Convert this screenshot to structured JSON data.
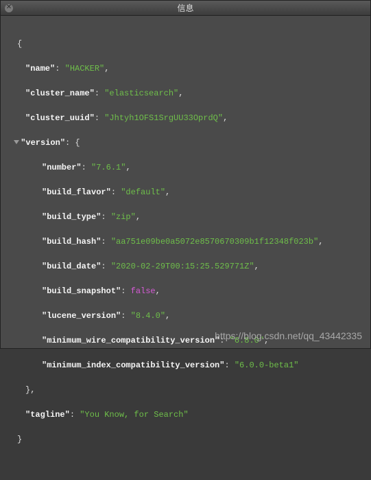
{
  "window": {
    "title": "信息"
  },
  "json": {
    "name_key": "\"name\"",
    "name_val": "\"HACKER\"",
    "cluster_name_key": "\"cluster_name\"",
    "cluster_name_val": "\"elasticsearch\"",
    "cluster_uuid_key": "\"cluster_uuid\"",
    "cluster_uuid_val": "\"Jhtyh1OFS1SrgUU33OprdQ\"",
    "version_key": "\"version\"",
    "number_key": "\"number\"",
    "number_val": "\"7.6.1\"",
    "build_flavor_key": "\"build_flavor\"",
    "build_flavor_val": "\"default\"",
    "build_type_key": "\"build_type\"",
    "build_type_val": "\"zip\"",
    "build_hash_key": "\"build_hash\"",
    "build_hash_val": "\"aa751e09be0a5072e8570670309b1f12348f023b\"",
    "build_date_key": "\"build_date\"",
    "build_date_val": "\"2020-02-29T00:15:25.529771Z\"",
    "build_snapshot_key": "\"build_snapshot\"",
    "build_snapshot_val": "false",
    "lucene_version_key": "\"lucene_version\"",
    "lucene_version_val": "\"8.4.0\"",
    "min_wire_key": "\"minimum_wire_compatibility_version\"",
    "min_wire_val": "\"6.8.0\"",
    "min_index_key": "\"minimum_index_compatibility_version\"",
    "min_index_val": "\"6.0.0-beta1\"",
    "tagline_key": "\"tagline\"",
    "tagline_val": "\"You Know, for Search\""
  },
  "watermark": "https://blog.csdn.net/qq_43442335"
}
